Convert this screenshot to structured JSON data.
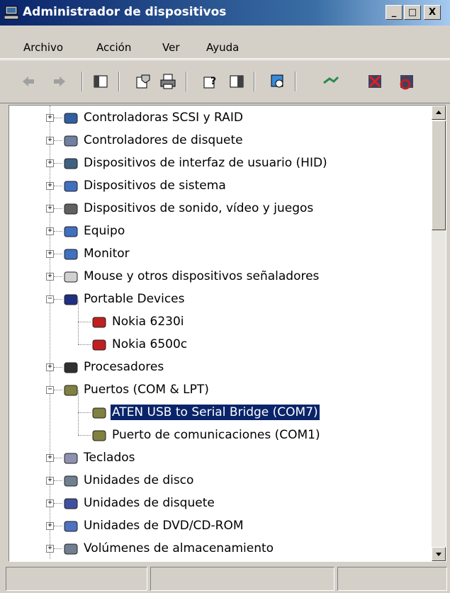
{
  "window": {
    "title": "Administrador de dispositivos",
    "minimize_label": "_",
    "maximize_label": "□",
    "close_label": "X"
  },
  "menu": {
    "items": [
      {
        "label": "Archivo"
      },
      {
        "label": "Acción"
      },
      {
        "label": "Ver"
      },
      {
        "label": "Ayuda"
      }
    ]
  },
  "toolbar": {
    "buttons": [
      "back-icon",
      "forward-icon",
      "console-tree-icon",
      "properties-icon",
      "print-icon",
      "help-icon",
      "show-hide-pane-icon",
      "scan-hardware-icon",
      "update-driver-icon",
      "uninstall-icon",
      "disable-icon"
    ]
  },
  "tree": {
    "items": [
      {
        "label": "Controladoras SCSI y RAID",
        "expanded": false,
        "selected": false
      },
      {
        "label": "Controladores de disquete",
        "expanded": false,
        "selected": false
      },
      {
        "label": "Dispositivos de interfaz de usuario (HID)",
        "expanded": false,
        "selected": false
      },
      {
        "label": "Dispositivos de sistema",
        "expanded": false,
        "selected": false
      },
      {
        "label": "Dispositivos de sonido, vídeo y juegos",
        "expanded": false,
        "selected": false
      },
      {
        "label": "Equipo",
        "expanded": false,
        "selected": false
      },
      {
        "label": "Monitor",
        "expanded": false,
        "selected": false
      },
      {
        "label": "Mouse y otros dispositivos señaladores",
        "expanded": false,
        "selected": false
      },
      {
        "label": "Portable Devices",
        "expanded": true,
        "selected": false
      },
      {
        "label": "Nokia 6230i",
        "child": true,
        "selected": false
      },
      {
        "label": "Nokia 6500c",
        "child": true,
        "selected": false
      },
      {
        "label": "Procesadores",
        "expanded": false,
        "selected": false
      },
      {
        "label": "Puertos (COM & LPT)",
        "expanded": true,
        "selected": false
      },
      {
        "label": "ATEN USB to Serial Bridge (COM7)",
        "child": true,
        "selected": true
      },
      {
        "label": "Puerto de comunicaciones (COM1)",
        "child": true,
        "selected": false
      },
      {
        "label": "Teclados",
        "expanded": false,
        "selected": false
      },
      {
        "label": "Unidades de disco",
        "expanded": false,
        "selected": false
      },
      {
        "label": "Unidades de disquete",
        "expanded": false,
        "selected": false
      },
      {
        "label": "Unidades de DVD/CD-ROM",
        "expanded": false,
        "selected": false
      },
      {
        "label": "Volúmenes de almacenamiento",
        "expanded": false,
        "selected": false
      }
    ],
    "expander_plus": "+",
    "expander_minus": "−"
  },
  "colors": {
    "selection": "#0a246a",
    "titlebar_start": "#0a246a",
    "titlebar_end": "#a6caf0"
  }
}
